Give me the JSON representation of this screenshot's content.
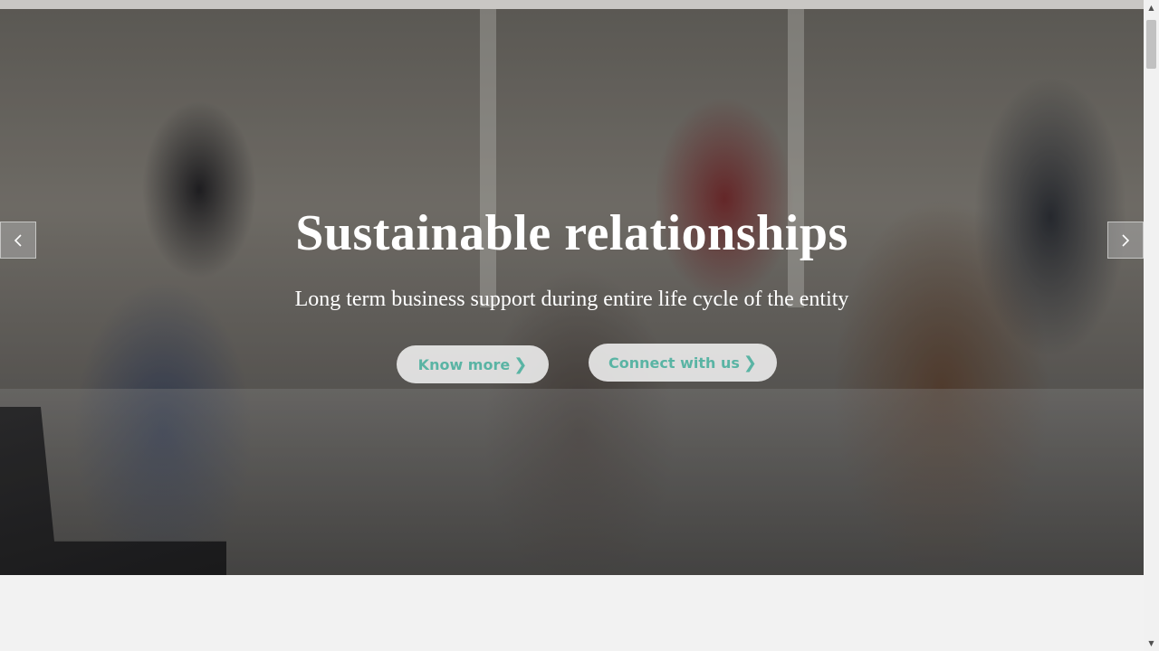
{
  "hero": {
    "title": "Sustainable relationships",
    "subtitle": "Long term business support during entire life cycle of the entity",
    "buttons": [
      {
        "label": "Know more",
        "icon": "chevron-right-icon"
      },
      {
        "label": "Connect with us",
        "icon": "chevron-right-icon"
      }
    ],
    "accent_color": "#5ab4a4"
  },
  "carousel": {
    "prev_icon": "chevron-left-icon",
    "next_icon": "chevron-right-icon"
  },
  "scrollbar": {
    "up_glyph": "▲",
    "down_glyph": "▼"
  }
}
